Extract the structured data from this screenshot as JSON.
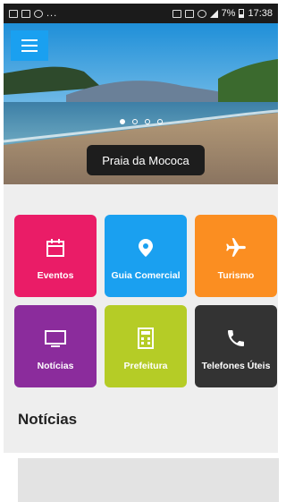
{
  "status_bar": {
    "battery": "7%",
    "time": "17:38",
    "left_icons": [
      "image-icon",
      "facebook-icon",
      "instagram-icon"
    ],
    "left_more": "..."
  },
  "hero": {
    "caption": "Praia da Mococa",
    "slide_count": 4,
    "active_slide": 1,
    "menu_icon": "hamburger-menu-icon"
  },
  "tiles": [
    {
      "label": "Eventos",
      "color": "#ea1c67",
      "icon": "calendar-icon"
    },
    {
      "label": "Guia Comercial",
      "color": "#1aa0f0",
      "icon": "location-pin-icon"
    },
    {
      "label": "Turismo",
      "color": "#fb8e21",
      "icon": "airplane-icon"
    },
    {
      "label": "Notícias",
      "color": "#8b2c9c",
      "icon": "tv-icon"
    },
    {
      "label": "Prefeitura",
      "color": "#b5cc26",
      "icon": "calculator-icon"
    },
    {
      "label": "Telefones Úteis",
      "color": "#333333",
      "icon": "phone-icon"
    }
  ],
  "news": {
    "title": "Notícias"
  }
}
